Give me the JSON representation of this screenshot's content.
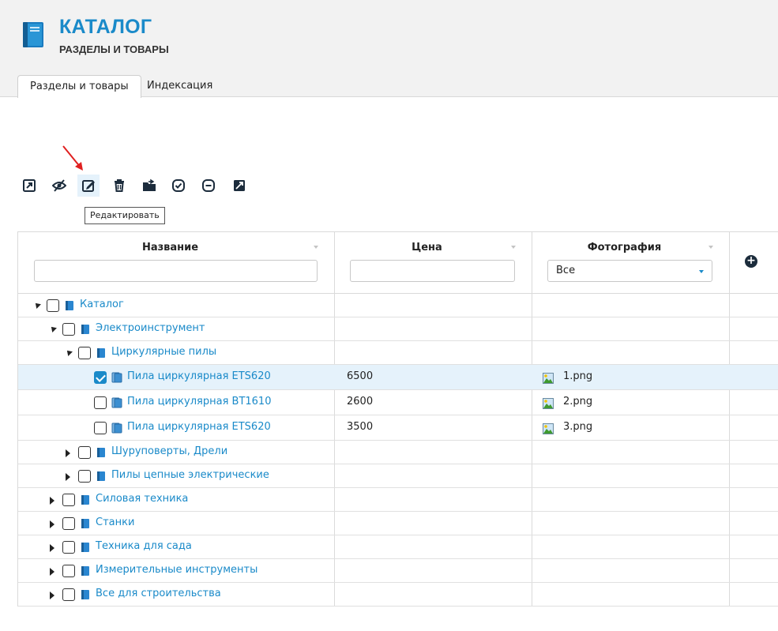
{
  "header": {
    "title": "КАТАЛОГ",
    "subtitle": "РАЗДЕЛЫ И ТОВАРЫ",
    "tabs": [
      {
        "label": "Разделы и товары",
        "active": true
      },
      {
        "label": "Индексация",
        "active": false
      }
    ]
  },
  "toolbar": {
    "buttons": [
      {
        "icon": "open-window-icon"
      },
      {
        "icon": "eye-slash-icon"
      },
      {
        "icon": "edit-icon"
      },
      {
        "icon": "trash-icon"
      },
      {
        "icon": "folder-move-icon"
      },
      {
        "icon": "check-circle-icon"
      },
      {
        "icon": "minus-circle-icon"
      },
      {
        "icon": "external-edit-icon"
      }
    ],
    "tooltip": "Редактировать"
  },
  "grid": {
    "columns": [
      "Название",
      "Цена",
      "Фотография"
    ],
    "photo_filter_value": "Все",
    "rows": [
      {
        "name": "Каталог",
        "level": 0,
        "state": "expanded",
        "type": "section",
        "checked": false,
        "price": "",
        "photo": ""
      },
      {
        "name": "Электроинструмент",
        "level": 1,
        "state": "expanded",
        "type": "section",
        "checked": false,
        "price": "",
        "photo": ""
      },
      {
        "name": "Циркулярные пилы",
        "level": 2,
        "state": "expanded",
        "type": "section",
        "checked": false,
        "price": "",
        "photo": ""
      },
      {
        "name": "Пила циркулярная ETS620",
        "level": 3,
        "state": "leaf",
        "type": "product",
        "checked": true,
        "price": "6500",
        "photo": "1.png"
      },
      {
        "name": "Пила циркулярная BT1610",
        "level": 3,
        "state": "leaf",
        "type": "product",
        "checked": false,
        "price": "2600",
        "photo": "2.png"
      },
      {
        "name": "Пила циркулярная ETS620",
        "level": 3,
        "state": "leaf",
        "type": "product",
        "checked": false,
        "price": "3500",
        "photo": "3.png"
      },
      {
        "name": "Шуруповерты, Дрели",
        "level": 2,
        "state": "collapsed",
        "type": "section",
        "checked": false,
        "price": "",
        "photo": ""
      },
      {
        "name": "Пилы цепные электрические",
        "level": 2,
        "state": "collapsed",
        "type": "section",
        "checked": false,
        "price": "",
        "photo": ""
      },
      {
        "name": "Силовая техника",
        "level": 1,
        "state": "collapsed",
        "type": "section",
        "checked": false,
        "price": "",
        "photo": ""
      },
      {
        "name": "Станки",
        "level": 1,
        "state": "collapsed",
        "type": "section",
        "checked": false,
        "price": "",
        "photo": ""
      },
      {
        "name": "Техника для сада",
        "level": 1,
        "state": "collapsed",
        "type": "section",
        "checked": false,
        "price": "",
        "photo": ""
      },
      {
        "name": "Измерительные инструменты",
        "level": 1,
        "state": "collapsed",
        "type": "section",
        "checked": false,
        "price": "",
        "photo": ""
      },
      {
        "name": "Все для строительства",
        "level": 1,
        "state": "collapsed",
        "type": "section",
        "checked": false,
        "price": "",
        "photo": ""
      }
    ]
  },
  "colors": {
    "accent": "#1a8ac9",
    "selected_row": "#e5f2fb",
    "annotation_arrow": "#e02020"
  }
}
